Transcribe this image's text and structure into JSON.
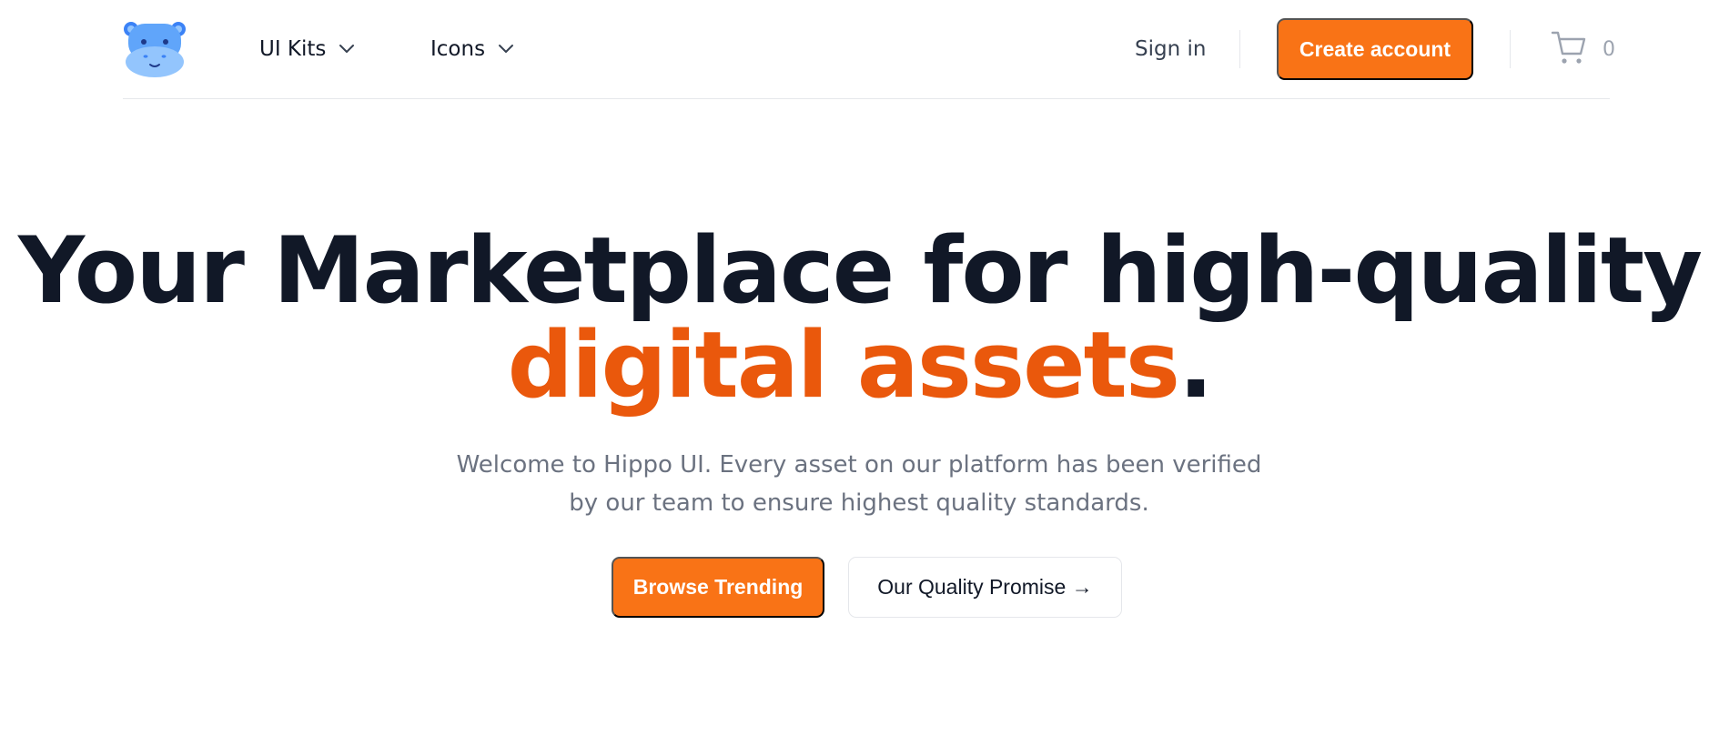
{
  "navbar": {
    "logo_icon": "hippo-logo-icon",
    "menu": [
      {
        "label": "UI Kits",
        "icon": "chevron-down-icon"
      },
      {
        "label": "Icons",
        "icon": "chevron-down-icon"
      }
    ],
    "sign_in": "Sign in",
    "create_account": "Create account",
    "cart": {
      "icon": "cart-icon",
      "count": "0"
    }
  },
  "hero": {
    "title_part1": "Your Marketplace for high-quality ",
    "title_accent": "digital assets",
    "title_end": ".",
    "subtitle": "Welcome to Hippo UI. Every asset on our platform has been verified by our team to ensure highest quality standards.",
    "primary_button": "Browse Trending",
    "secondary_button": "Our Quality Promise →"
  },
  "colors": {
    "accent": "#f97316",
    "accent_text": "#ea580c",
    "heading": "#111827",
    "muted": "#6b7280",
    "border": "#e5e7eb",
    "logo_blue": "#60a5fa"
  }
}
